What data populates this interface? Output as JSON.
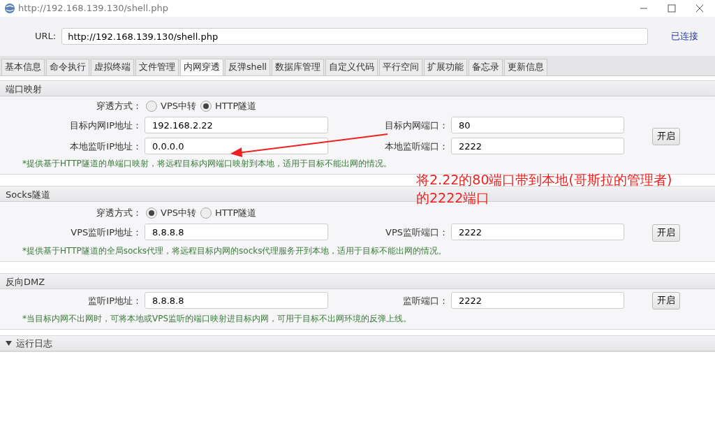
{
  "window": {
    "title": "http://192.168.139.130/shell.php"
  },
  "url_bar": {
    "label": "URL:",
    "value": "http://192.168.139.130/shell.php",
    "status": "已连接"
  },
  "tabs": [
    {
      "label": "基本信息",
      "selected": false
    },
    {
      "label": "命令执行",
      "selected": false
    },
    {
      "label": "虚拟终端",
      "selected": false
    },
    {
      "label": "文件管理",
      "selected": false
    },
    {
      "label": "内网穿透",
      "selected": true
    },
    {
      "label": "反弹shell",
      "selected": false
    },
    {
      "label": "数据库管理",
      "selected": false
    },
    {
      "label": "自定义代码",
      "selected": false
    },
    {
      "label": "平行空间",
      "selected": false
    },
    {
      "label": "扩展功能",
      "selected": false
    },
    {
      "label": "备忘录",
      "selected": false
    },
    {
      "label": "更新信息",
      "selected": false
    }
  ],
  "sections": [
    {
      "title": "端口映射",
      "mode": {
        "label": "穿透方式：",
        "options": [
          {
            "label": "VPS中转",
            "selected": false
          },
          {
            "label": "HTTP隧道",
            "selected": true
          }
        ]
      },
      "rows": [
        {
          "left": {
            "label": "目标内网IP地址：",
            "value": "192.168.2.22"
          },
          "right": {
            "label": "目标内网端口：",
            "value": "80"
          }
        },
        {
          "left": {
            "label": "本地监听IP地址：",
            "value": "0.0.0.0"
          },
          "right": {
            "label": "本地监听端口：",
            "value": "2222"
          }
        }
      ],
      "button": "开启",
      "note": "*提供基于HTTP隧道的单端口映射，将远程目标内网端口映射到本地，适用于目标不能出网的情况。"
    },
    {
      "title": "Socks隧道",
      "mode": {
        "label": "穿透方式：",
        "options": [
          {
            "label": "VPS中转",
            "selected": true
          },
          {
            "label": "HTTP隧道",
            "selected": false
          }
        ]
      },
      "rows": [
        {
          "left": {
            "label": "VPS监听IP地址：",
            "value": "8.8.8.8"
          },
          "right": {
            "label": "VPS监听端口：",
            "value": "2222"
          }
        }
      ],
      "button": "开启",
      "note": "*提供基于HTTP隧道的全局socks代理，将远程目标内网的socks代理服务开到本地，适用于目标不能出网的情况。"
    },
    {
      "title": "反向DMZ",
      "rows": [
        {
          "left": {
            "label": "监听IP地址：",
            "value": "8.8.8.8"
          },
          "right": {
            "label": "监听端口：",
            "value": "2222"
          }
        }
      ],
      "button": "开启",
      "note": "*当目标内网不出网时，可将本地或VPS监听的端口映射进目标内网，可用于目标不出网环境的反弹上线。"
    }
  ],
  "log_panel": {
    "title": "运行日志",
    "expanded": true
  },
  "annotation": {
    "lines": [
      "将2.22的80端口带到本地(哥斯拉的管理者)",
      "的2222端口"
    ]
  }
}
